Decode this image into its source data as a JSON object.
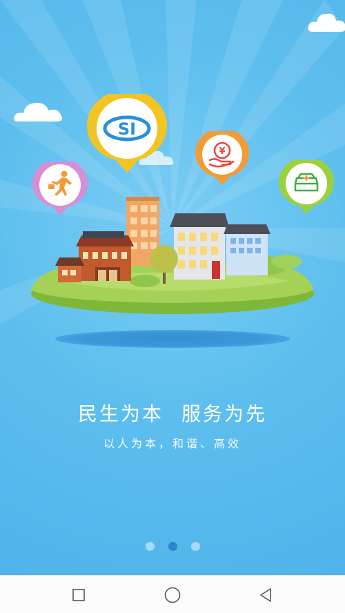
{
  "splash": {
    "slogan_left": "民生为本",
    "slogan_right": "服务为先",
    "subtitle": "以人为本，和谐、高效",
    "page_indicator": {
      "total": 3,
      "current": 2
    },
    "pins": [
      {
        "icon": "social-security-logo-icon",
        "label": "SI"
      },
      {
        "icon": "person-running-icon"
      },
      {
        "icon": "yuan-hand-icon",
        "label": "¥"
      },
      {
        "icon": "medical-kit-icon"
      }
    ]
  },
  "colors": {
    "sky": "#5ebfee",
    "pin_yellow": "#f3c522",
    "pin_orange": "#f39b35",
    "pin_green": "#9bd13b",
    "pin_purple": "#d58fd6",
    "indicator_active": "#2f84cf",
    "indicator_inactive": "#a7d9f6"
  },
  "navbar": {
    "buttons": [
      "recents-square-icon",
      "home-circle-icon",
      "back-triangle-icon"
    ]
  }
}
